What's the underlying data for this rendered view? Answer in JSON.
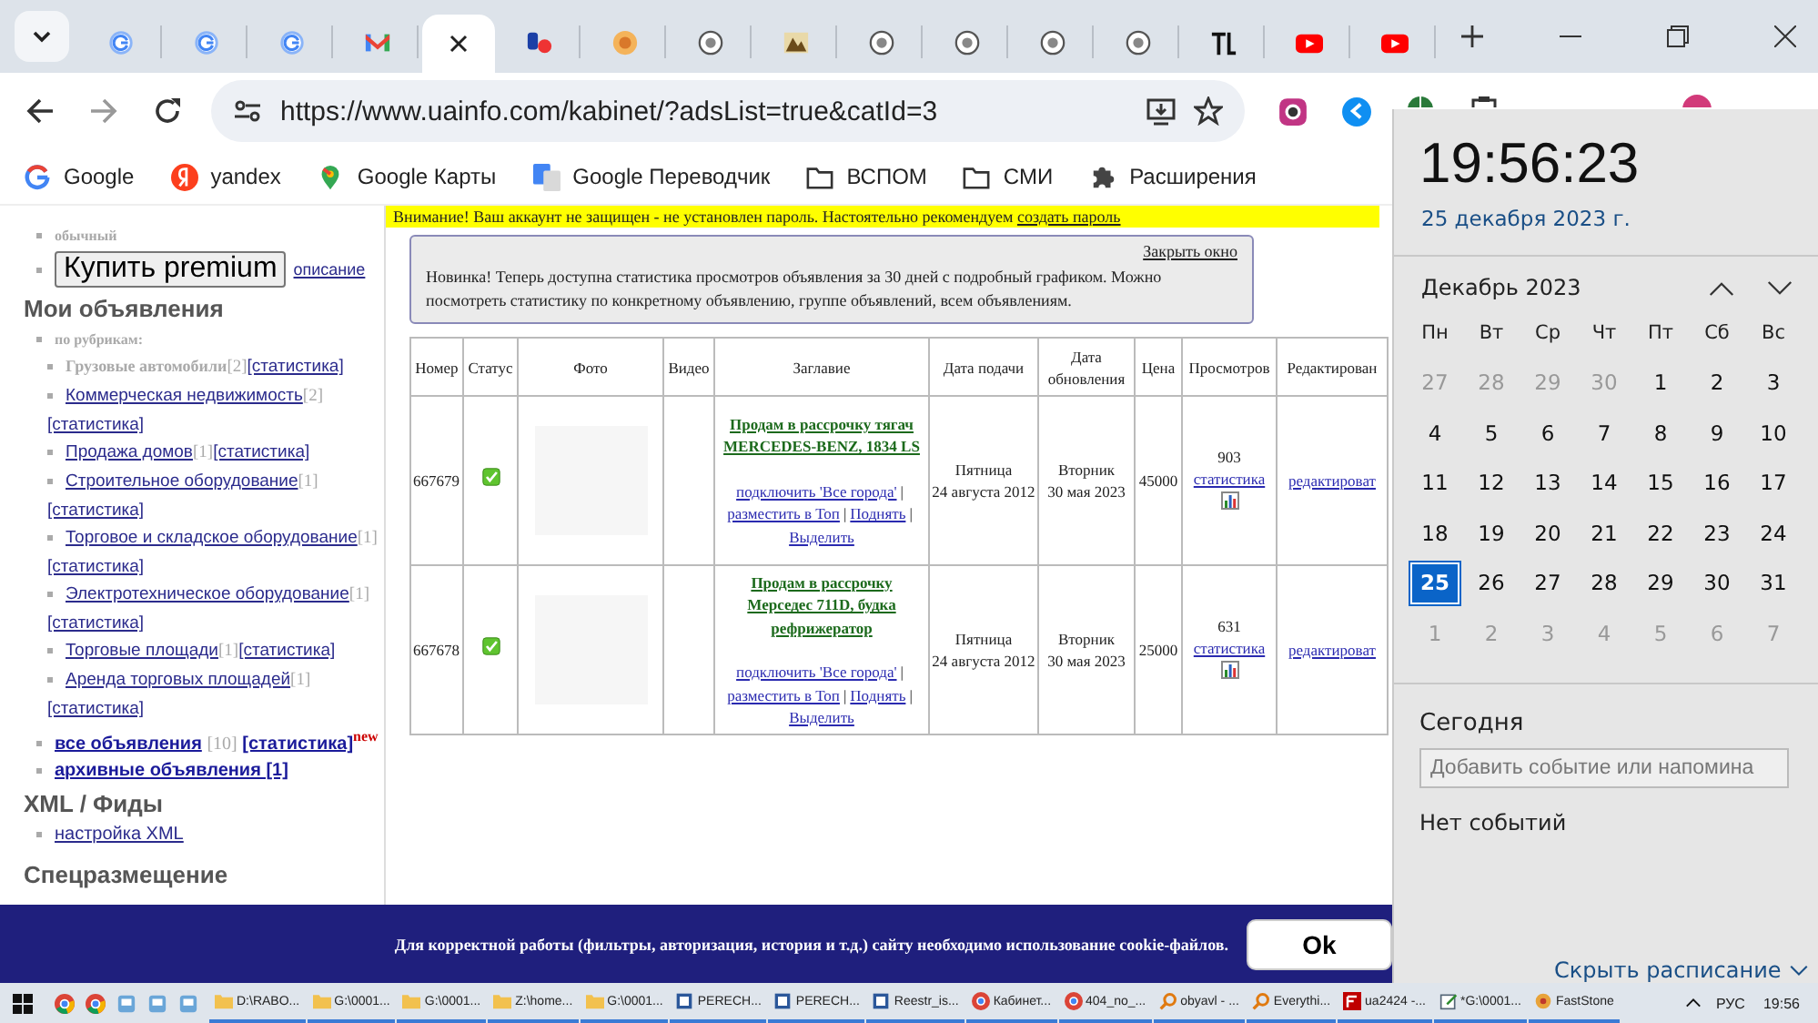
{
  "browser": {
    "tabs": [
      {
        "kind": "google",
        "selected": false
      },
      {
        "kind": "google",
        "selected": false
      },
      {
        "kind": "google",
        "selected": false
      },
      {
        "kind": "gmail",
        "selected": false
      },
      {
        "kind": "none",
        "selected": true
      },
      {
        "kind": "ua",
        "selected": false
      },
      {
        "kind": "orange",
        "selected": false
      },
      {
        "kind": "round",
        "selected": false
      },
      {
        "kind": "image",
        "selected": false
      },
      {
        "kind": "round",
        "selected": false
      },
      {
        "kind": "round",
        "selected": false
      },
      {
        "kind": "round",
        "selected": false
      },
      {
        "kind": "round",
        "selected": false
      },
      {
        "kind": "bars",
        "selected": false
      },
      {
        "kind": "youtube",
        "selected": false
      },
      {
        "kind": "youtube",
        "selected": false
      }
    ],
    "url": "https://www.uainfo.com/kabinet/?adsList=true&catId=3",
    "bookmarks": [
      {
        "kind": "google",
        "label": "Google"
      },
      {
        "kind": "yandex",
        "label": "yandex"
      },
      {
        "kind": "maps",
        "label": "Google Карты"
      },
      {
        "kind": "translate",
        "label": "Google Переводчик"
      },
      {
        "kind": "folder",
        "label": "ВСПОМ"
      },
      {
        "kind": "folder",
        "label": "СМИ"
      },
      {
        "kind": "puzzle",
        "label": "Расширения"
      }
    ]
  },
  "sidebar": {
    "plan_label": "обычный",
    "premium_button": "Купить premium",
    "premium_link": "описание",
    "my_ads": {
      "heading": "Мои объявления",
      "by_category_label": "по рубрикам:",
      "categories": [
        {
          "name": "Грузовые автомобили",
          "linked": false,
          "count": "[2]",
          "stats": "[статистика]"
        },
        {
          "name": "Коммерческая недвижимость",
          "linked": true,
          "count": "[2]",
          "stats": "[статистика]"
        },
        {
          "name": "Продажа домов",
          "linked": true,
          "count": "[1]",
          "stats": "[статистика]"
        },
        {
          "name": "Строительное оборудование",
          "linked": true,
          "count": "[1]",
          "stats": "[статистика]"
        },
        {
          "name": "Торговое и складское оборудование",
          "linked": true,
          "count": "[1]",
          "stats": "[статистика]"
        },
        {
          "name": "Электротехническое оборудование",
          "linked": true,
          "count": "[1]",
          "stats": "[статистика]"
        },
        {
          "name": "Торговые площади",
          "linked": true,
          "count": "[1]",
          "stats": "[статистика]"
        },
        {
          "name": "Аренда торговых площадей",
          "linked": true,
          "count": "[1]",
          "stats": "[статистика]"
        }
      ],
      "all_ads": {
        "label": "все объявления",
        "count": "[10]",
        "stats": "[статистика]",
        "badge": "new"
      },
      "archive": "архивные объявления [1]"
    },
    "xml": {
      "heading": "XML / Фиды",
      "links": [
        "настройка XML"
      ]
    },
    "special": {
      "heading": "Спецразмещение"
    }
  },
  "warning": {
    "text": "Внимание! Ваш аккаунт не защищен - не установлен пароль. Настоятельно рекомендуем",
    "link": "создать пароль"
  },
  "notice": {
    "close_link": "Закрыть окно",
    "text": "Новинка! Теперь доступна статистика просмотров объявления за 30 дней с подробный графиком. Можно посмотреть статистику по конкретному объявлению, группе объявлений, всем объявлениям."
  },
  "table": {
    "columns": [
      "Номер",
      "Статус",
      "Фото",
      "Видео",
      "Заглавие",
      "Дата подачи",
      "Дата обновления",
      "Цена",
      "Просмотров",
      "Редактирован"
    ],
    "separator": "|",
    "rows": [
      {
        "number": "667679",
        "active": true,
        "title": "Продам в рассрочку тягач MERCEDES-BENZ, 1834 LS",
        "actions": [
          "подключить 'Все города'",
          "разместить в Топ",
          "Поднять",
          "Выделить"
        ],
        "posted": [
          "Пятница",
          "24 августа 2012"
        ],
        "updated": [
          "Вторник",
          "30 мая 2023"
        ],
        "price": "45000",
        "views": "903",
        "stats_link": "статистика",
        "edit_link": "редактироват"
      },
      {
        "number": "667678",
        "active": true,
        "title": "Продам в рассрочку Мерседес 711D, будка рефрижератор",
        "actions": [
          "подключить 'Все города'",
          "разместить в Топ",
          "Поднять",
          "Выделить"
        ],
        "posted": [
          "Пятница",
          "24 августа 2012"
        ],
        "updated": [
          "Вторник",
          "30 мая 2023"
        ],
        "price": "25000",
        "views": "631",
        "stats_link": "статистика",
        "edit_link": "редактироват"
      }
    ]
  },
  "cookie": {
    "text": "Для корректной работы (фильтры, авторизация, история и т.д.) сайту необходимо использование cookie-файлов.",
    "button": "Ok"
  },
  "calendar": {
    "time": "19:56:23",
    "date": "25 декабря 2023 г.",
    "month": "Декабрь 2023",
    "weekdays": [
      "Пн",
      "Вт",
      "Ср",
      "Чт",
      "Пт",
      "Сб",
      "Вс"
    ],
    "days": [
      {
        "label": "27",
        "current_month": false,
        "selected": false
      },
      {
        "label": "28",
        "current_month": false,
        "selected": false
      },
      {
        "label": "29",
        "current_month": false,
        "selected": false
      },
      {
        "label": "30",
        "current_month": false,
        "selected": false
      },
      {
        "label": "1",
        "current_month": true,
        "selected": false
      },
      {
        "label": "2",
        "current_month": true,
        "selected": false
      },
      {
        "label": "3",
        "current_month": true,
        "selected": false
      },
      {
        "label": "4",
        "current_month": true,
        "selected": false
      },
      {
        "label": "5",
        "current_month": true,
        "selected": false
      },
      {
        "label": "6",
        "current_month": true,
        "selected": false
      },
      {
        "label": "7",
        "current_month": true,
        "selected": false
      },
      {
        "label": "8",
        "current_month": true,
        "selected": false
      },
      {
        "label": "9",
        "current_month": true,
        "selected": false
      },
      {
        "label": "10",
        "current_month": true,
        "selected": false
      },
      {
        "label": "11",
        "current_month": true,
        "selected": false
      },
      {
        "label": "12",
        "current_month": true,
        "selected": false
      },
      {
        "label": "13",
        "current_month": true,
        "selected": false
      },
      {
        "label": "14",
        "current_month": true,
        "selected": false
      },
      {
        "label": "15",
        "current_month": true,
        "selected": false
      },
      {
        "label": "16",
        "current_month": true,
        "selected": false
      },
      {
        "label": "17",
        "current_month": true,
        "selected": false
      },
      {
        "label": "18",
        "current_month": true,
        "selected": false
      },
      {
        "label": "19",
        "current_month": true,
        "selected": false
      },
      {
        "label": "20",
        "current_month": true,
        "selected": false
      },
      {
        "label": "21",
        "current_month": true,
        "selected": false
      },
      {
        "label": "22",
        "current_month": true,
        "selected": false
      },
      {
        "label": "23",
        "current_month": true,
        "selected": false
      },
      {
        "label": "24",
        "current_month": true,
        "selected": false
      },
      {
        "label": "25",
        "current_month": true,
        "selected": true
      },
      {
        "label": "26",
        "current_month": true,
        "selected": false
      },
      {
        "label": "27",
        "current_month": true,
        "selected": false
      },
      {
        "label": "28",
        "current_month": true,
        "selected": false
      },
      {
        "label": "29",
        "current_month": true,
        "selected": false
      },
      {
        "label": "30",
        "current_month": true,
        "selected": false
      },
      {
        "label": "31",
        "current_month": true,
        "selected": false
      },
      {
        "label": "1",
        "current_month": false,
        "selected": false
      },
      {
        "label": "2",
        "current_month": false,
        "selected": false
      },
      {
        "label": "3",
        "current_month": false,
        "selected": false
      },
      {
        "label": "4",
        "current_month": false,
        "selected": false
      },
      {
        "label": "5",
        "current_month": false,
        "selected": false
      },
      {
        "label": "6",
        "current_month": false,
        "selected": false
      },
      {
        "label": "7",
        "current_month": false,
        "selected": false
      }
    ],
    "today_heading": "Сегодня",
    "event_placeholder": "Добавить событие или напомина",
    "no_events": "Нет событий",
    "hide_link": "Скрыть расписание"
  },
  "taskbar": {
    "tasks": [
      {
        "kind": "folder",
        "label": "D:\\RABO..."
      },
      {
        "kind": "folder",
        "label": "G:\\0001..."
      },
      {
        "kind": "folder",
        "label": "G:\\0001..."
      },
      {
        "kind": "folder",
        "label": "Z:\\home..."
      },
      {
        "kind": "folder",
        "label": "G:\\0001..."
      },
      {
        "kind": "doc",
        "label": "PERECH..."
      },
      {
        "kind": "doc",
        "label": "PERECH..."
      },
      {
        "kind": "doc",
        "label": "Reestr_is..."
      },
      {
        "kind": "chrome",
        "label": "Кабинет..."
      },
      {
        "kind": "chrome",
        "label": "404_no_..."
      },
      {
        "kind": "search",
        "label": "obyavl - ..."
      },
      {
        "kind": "search",
        "label": "Everythi..."
      },
      {
        "kind": "ftp",
        "label": "ua2424 -..."
      },
      {
        "kind": "notepad",
        "label": "*G:\\0001..."
      },
      {
        "kind": "app",
        "label": "FastStone"
      }
    ],
    "language": "РУС",
    "time": "19:56"
  }
}
